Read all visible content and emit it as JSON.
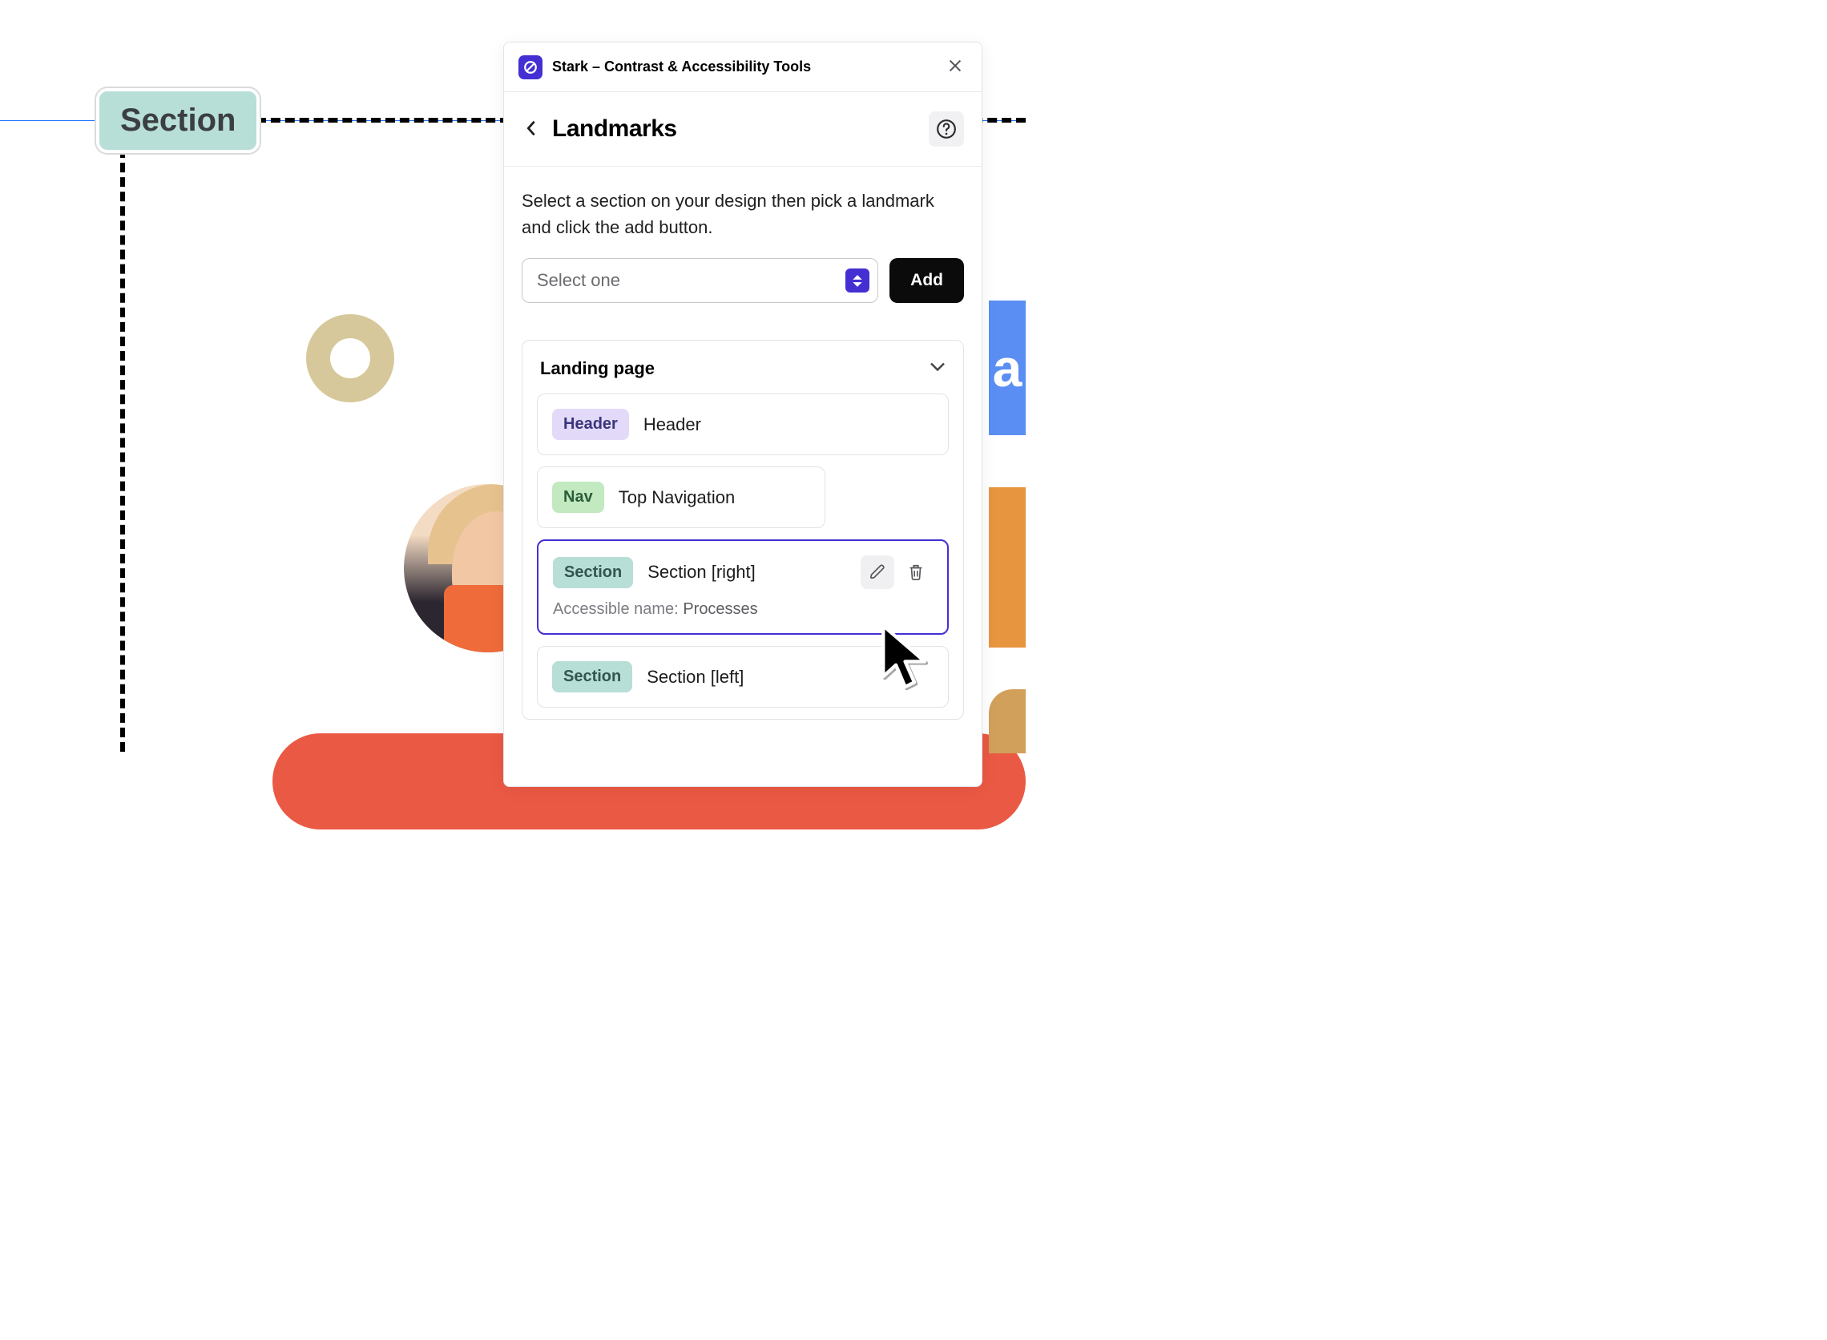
{
  "canvas": {
    "badge_label": "Section",
    "side_blue_text": "a"
  },
  "plugin": {
    "title": "Stark – Contrast & Accessibility Tools",
    "section_title": "Landmarks",
    "instruction": "Select a section on your design then pick a landmark and click the add button.",
    "select_placeholder": "Select one",
    "add_button": "Add",
    "frame_name": "Landing page",
    "accessible_name_label": "Accessible name:",
    "items": [
      {
        "tag": "Header",
        "label": "Header",
        "tag_class": "tag-header",
        "selected": false
      },
      {
        "tag": "Nav",
        "label": "Top Navigation",
        "tag_class": "tag-nav",
        "selected": false
      },
      {
        "tag": "Section",
        "label": "Section [right]",
        "tag_class": "tag-section",
        "selected": true,
        "accessible_name": "Processes",
        "show_actions": true
      },
      {
        "tag": "Section",
        "label": "Section [left]",
        "tag_class": "tag-section",
        "selected": false
      }
    ]
  }
}
